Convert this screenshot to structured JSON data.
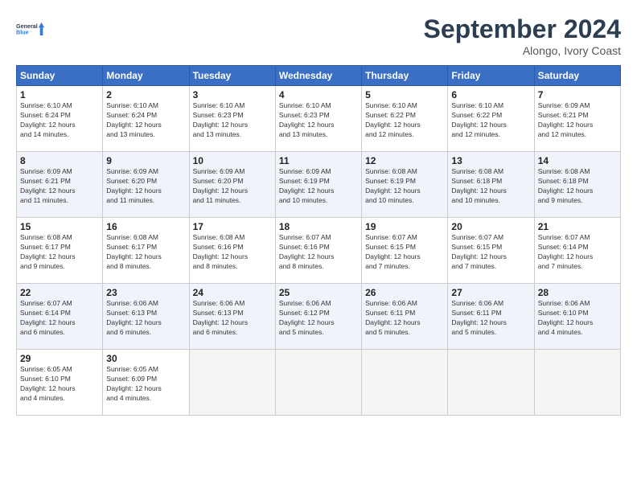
{
  "header": {
    "logo_general": "General",
    "logo_blue": "Blue",
    "month": "September 2024",
    "location": "Alongo, Ivory Coast"
  },
  "days_of_week": [
    "Sunday",
    "Monday",
    "Tuesday",
    "Wednesday",
    "Thursday",
    "Friday",
    "Saturday"
  ],
  "weeks": [
    [
      {
        "day": "1",
        "info": "Sunrise: 6:10 AM\nSunset: 6:24 PM\nDaylight: 12 hours\nand 14 minutes."
      },
      {
        "day": "2",
        "info": "Sunrise: 6:10 AM\nSunset: 6:24 PM\nDaylight: 12 hours\nand 13 minutes."
      },
      {
        "day": "3",
        "info": "Sunrise: 6:10 AM\nSunset: 6:23 PM\nDaylight: 12 hours\nand 13 minutes."
      },
      {
        "day": "4",
        "info": "Sunrise: 6:10 AM\nSunset: 6:23 PM\nDaylight: 12 hours\nand 13 minutes."
      },
      {
        "day": "5",
        "info": "Sunrise: 6:10 AM\nSunset: 6:22 PM\nDaylight: 12 hours\nand 12 minutes."
      },
      {
        "day": "6",
        "info": "Sunrise: 6:10 AM\nSunset: 6:22 PM\nDaylight: 12 hours\nand 12 minutes."
      },
      {
        "day": "7",
        "info": "Sunrise: 6:09 AM\nSunset: 6:21 PM\nDaylight: 12 hours\nand 12 minutes."
      }
    ],
    [
      {
        "day": "8",
        "info": "Sunrise: 6:09 AM\nSunset: 6:21 PM\nDaylight: 12 hours\nand 11 minutes."
      },
      {
        "day": "9",
        "info": "Sunrise: 6:09 AM\nSunset: 6:20 PM\nDaylight: 12 hours\nand 11 minutes."
      },
      {
        "day": "10",
        "info": "Sunrise: 6:09 AM\nSunset: 6:20 PM\nDaylight: 12 hours\nand 11 minutes."
      },
      {
        "day": "11",
        "info": "Sunrise: 6:09 AM\nSunset: 6:19 PM\nDaylight: 12 hours\nand 10 minutes."
      },
      {
        "day": "12",
        "info": "Sunrise: 6:08 AM\nSunset: 6:19 PM\nDaylight: 12 hours\nand 10 minutes."
      },
      {
        "day": "13",
        "info": "Sunrise: 6:08 AM\nSunset: 6:18 PM\nDaylight: 12 hours\nand 10 minutes."
      },
      {
        "day": "14",
        "info": "Sunrise: 6:08 AM\nSunset: 6:18 PM\nDaylight: 12 hours\nand 9 minutes."
      }
    ],
    [
      {
        "day": "15",
        "info": "Sunrise: 6:08 AM\nSunset: 6:17 PM\nDaylight: 12 hours\nand 9 minutes."
      },
      {
        "day": "16",
        "info": "Sunrise: 6:08 AM\nSunset: 6:17 PM\nDaylight: 12 hours\nand 8 minutes."
      },
      {
        "day": "17",
        "info": "Sunrise: 6:08 AM\nSunset: 6:16 PM\nDaylight: 12 hours\nand 8 minutes."
      },
      {
        "day": "18",
        "info": "Sunrise: 6:07 AM\nSunset: 6:16 PM\nDaylight: 12 hours\nand 8 minutes."
      },
      {
        "day": "19",
        "info": "Sunrise: 6:07 AM\nSunset: 6:15 PM\nDaylight: 12 hours\nand 7 minutes."
      },
      {
        "day": "20",
        "info": "Sunrise: 6:07 AM\nSunset: 6:15 PM\nDaylight: 12 hours\nand 7 minutes."
      },
      {
        "day": "21",
        "info": "Sunrise: 6:07 AM\nSunset: 6:14 PM\nDaylight: 12 hours\nand 7 minutes."
      }
    ],
    [
      {
        "day": "22",
        "info": "Sunrise: 6:07 AM\nSunset: 6:14 PM\nDaylight: 12 hours\nand 6 minutes."
      },
      {
        "day": "23",
        "info": "Sunrise: 6:06 AM\nSunset: 6:13 PM\nDaylight: 12 hours\nand 6 minutes."
      },
      {
        "day": "24",
        "info": "Sunrise: 6:06 AM\nSunset: 6:13 PM\nDaylight: 12 hours\nand 6 minutes."
      },
      {
        "day": "25",
        "info": "Sunrise: 6:06 AM\nSunset: 6:12 PM\nDaylight: 12 hours\nand 5 minutes."
      },
      {
        "day": "26",
        "info": "Sunrise: 6:06 AM\nSunset: 6:11 PM\nDaylight: 12 hours\nand 5 minutes."
      },
      {
        "day": "27",
        "info": "Sunrise: 6:06 AM\nSunset: 6:11 PM\nDaylight: 12 hours\nand 5 minutes."
      },
      {
        "day": "28",
        "info": "Sunrise: 6:06 AM\nSunset: 6:10 PM\nDaylight: 12 hours\nand 4 minutes."
      }
    ],
    [
      {
        "day": "29",
        "info": "Sunrise: 6:05 AM\nSunset: 6:10 PM\nDaylight: 12 hours\nand 4 minutes."
      },
      {
        "day": "30",
        "info": "Sunrise: 6:05 AM\nSunset: 6:09 PM\nDaylight: 12 hours\nand 4 minutes."
      },
      {
        "day": "",
        "info": ""
      },
      {
        "day": "",
        "info": ""
      },
      {
        "day": "",
        "info": ""
      },
      {
        "day": "",
        "info": ""
      },
      {
        "day": "",
        "info": ""
      }
    ]
  ]
}
